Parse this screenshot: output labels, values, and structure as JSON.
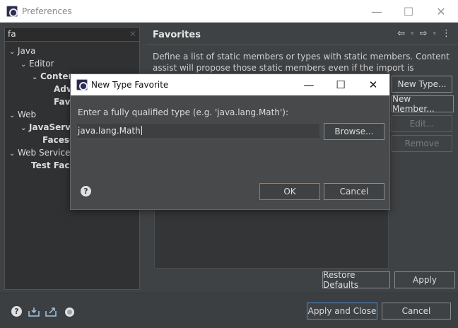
{
  "window": {
    "title": "Preferences",
    "min_glyph": "—",
    "max_glyph": "☐",
    "close_glyph": "✕"
  },
  "filter": {
    "value": "fa",
    "clear_glyph": "✕"
  },
  "tree": [
    {
      "label": "Java",
      "chevron": "⌄",
      "bold": false
    },
    {
      "label": "Editor",
      "chevron": "⌄",
      "bold": false
    },
    {
      "label": "Conten",
      "chevron": "⌄",
      "bold": true
    },
    {
      "label": "Adv",
      "chevron": "",
      "bold": true
    },
    {
      "label": "Favo",
      "chevron": "",
      "bold": true
    },
    {
      "label": "Web",
      "chevron": "⌄",
      "bold": false
    },
    {
      "label": "JavaServe",
      "chevron": "⌄",
      "bold": true
    },
    {
      "label": "FacesC",
      "chevron": "",
      "bold": true
    },
    {
      "label": "Web Services",
      "chevron": "⌄",
      "bold": false
    },
    {
      "label": "Test Facili",
      "chevron": "",
      "bold": true
    }
  ],
  "page": {
    "title": "Favorites",
    "description": "Define a list of static members or types with static members. Content assist will propose those static members even if the import is missing.",
    "nav": {
      "back": "⇦",
      "forward": "⇨",
      "menu": "⋮",
      "dropdown": "▾"
    },
    "buttons": {
      "new_type": "New Type...",
      "new_member": "New Member...",
      "edit": "Edit...",
      "remove": "Remove",
      "restore_defaults": "Restore Defaults",
      "apply": "Apply"
    }
  },
  "bottom": {
    "help_glyph": "?",
    "apply_and_close": "Apply and Close",
    "cancel": "Cancel"
  },
  "dialog": {
    "title": "New Type Favorite",
    "min_glyph": "—",
    "max_glyph": "☐",
    "close_glyph": "✕",
    "label": "Enter a fully qualified type (e.g. 'java.lang.Math'):",
    "input_value": "java.lang.Math",
    "browse": "Browse...",
    "ok": "OK",
    "cancel": "Cancel",
    "help_glyph": "?"
  },
  "colors": {
    "accent": "#4a8fd8",
    "background": "#3f4244"
  }
}
